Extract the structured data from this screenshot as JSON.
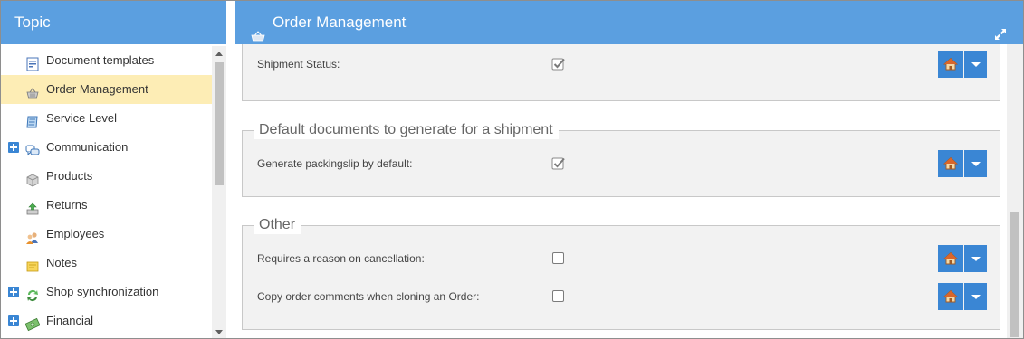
{
  "left_panel": {
    "title": "Topic",
    "items": [
      {
        "label": "Document templates",
        "icon": "document-template-icon",
        "expandable": false,
        "selected": false
      },
      {
        "label": "Order Management",
        "icon": "basket-icon",
        "expandable": false,
        "selected": true
      },
      {
        "label": "Service Level",
        "icon": "service-level-icon",
        "expandable": false,
        "selected": false
      },
      {
        "label": "Communication",
        "icon": "speech-bubbles-icon",
        "expandable": true,
        "selected": false
      },
      {
        "label": "Products",
        "icon": "box-icon",
        "expandable": false,
        "selected": false
      },
      {
        "label": "Returns",
        "icon": "returns-icon",
        "expandable": false,
        "selected": false
      },
      {
        "label": "Employees",
        "icon": "employees-icon",
        "expandable": false,
        "selected": false
      },
      {
        "label": "Notes",
        "icon": "notes-icon",
        "expandable": false,
        "selected": false
      },
      {
        "label": "Shop synchronization",
        "icon": "sync-icon",
        "expandable": true,
        "selected": false
      },
      {
        "label": "Financial",
        "icon": "money-icon",
        "expandable": true,
        "selected": false
      }
    ]
  },
  "right_panel": {
    "title": "Order Management",
    "groups": [
      {
        "legend": "",
        "rows": [
          {
            "label": "Shipment Status:",
            "checked": true
          }
        ]
      },
      {
        "legend": "Default documents to generate for a shipment",
        "rows": [
          {
            "label": "Generate packingslip by default:",
            "checked": true
          }
        ]
      },
      {
        "legend": "Other",
        "rows": [
          {
            "label": "Requires a reason on cancellation:",
            "checked": false
          },
          {
            "label": "Copy order comments when cloning an Order:",
            "checked": false
          }
        ]
      }
    ]
  },
  "colors": {
    "header": "#5b9fe0",
    "button": "#3a86d4",
    "selected_row": "#fdedb5"
  }
}
